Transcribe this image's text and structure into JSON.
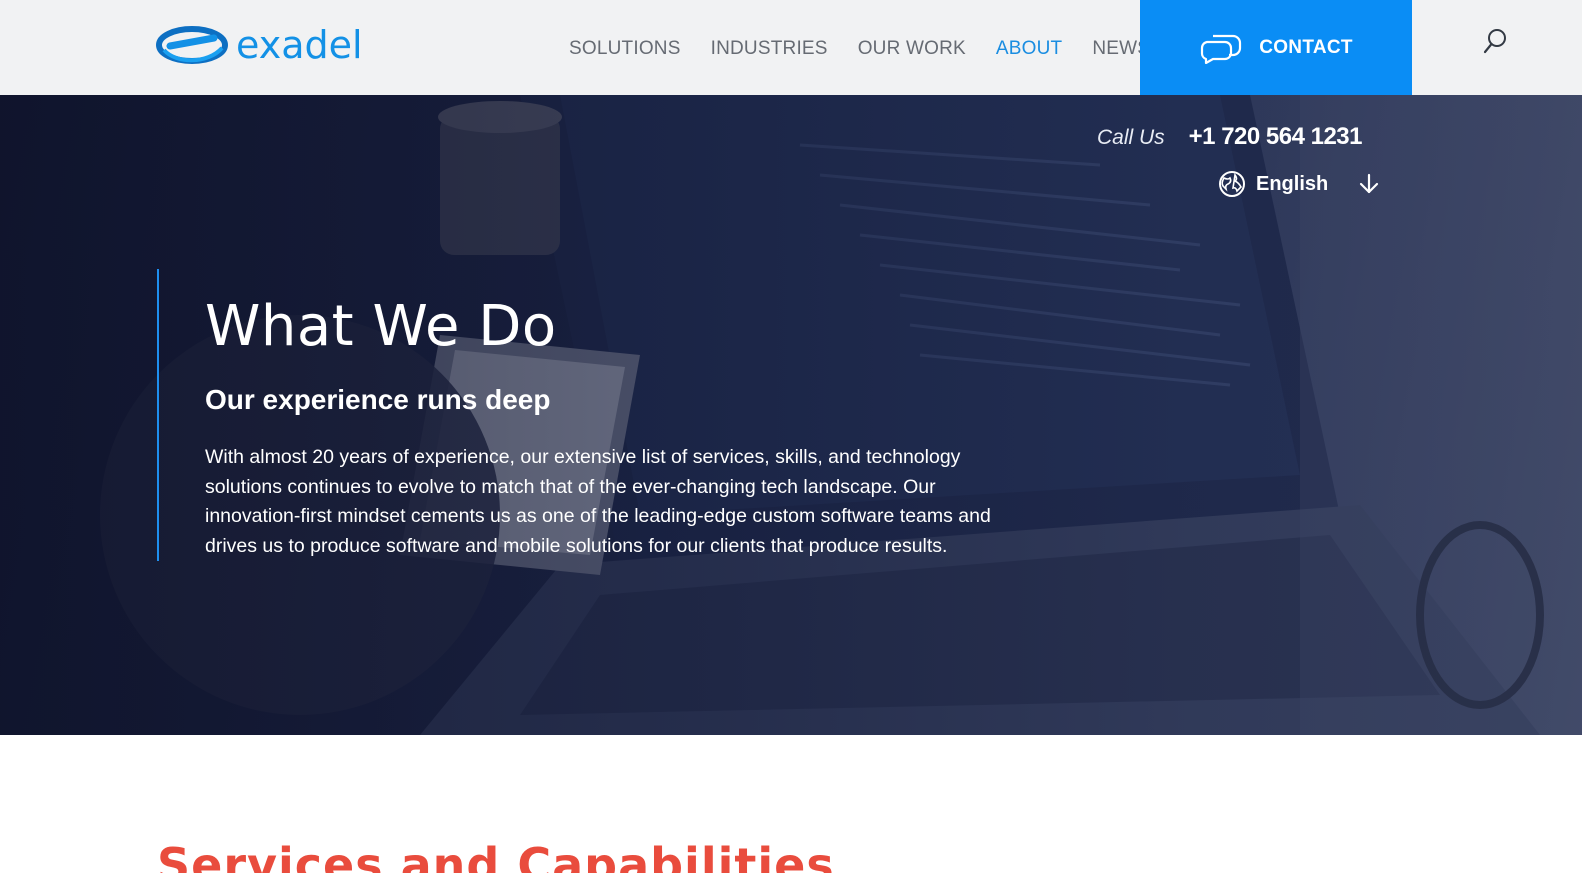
{
  "brand": {
    "name": "exadel",
    "colors": {
      "primary": "#1391e6",
      "contact": "#0a8df5",
      "accent_red": "#e94c3d"
    }
  },
  "nav": {
    "items": [
      {
        "label": "SOLUTIONS",
        "active": false
      },
      {
        "label": "INDUSTRIES",
        "active": false
      },
      {
        "label": "OUR WORK",
        "active": false
      },
      {
        "label": "ABOUT",
        "active": true
      },
      {
        "label": "NEWS",
        "active": false
      }
    ],
    "contact_label": "CONTACT",
    "contact_icon": "chat-bubbles-icon",
    "search_icon": "search-icon"
  },
  "hero": {
    "call_label": "Call Us",
    "phone": "+1 720 564 1231",
    "language": "English",
    "language_icon": "globe-icon",
    "language_arrow_icon": "arrow-down-icon",
    "title": "What We Do",
    "subtitle": "Our experience runs deep",
    "body": "With almost 20 years of experience, our extensive list of services, skills, and technology solutions continues to evolve to match that of the ever-changing tech landscape. Our innovation-first mindset cements us as one of the leading-edge custom software teams and drives us to produce software and mobile solutions for our clients that produce results."
  },
  "section": {
    "title": "Services and Capabilities"
  }
}
